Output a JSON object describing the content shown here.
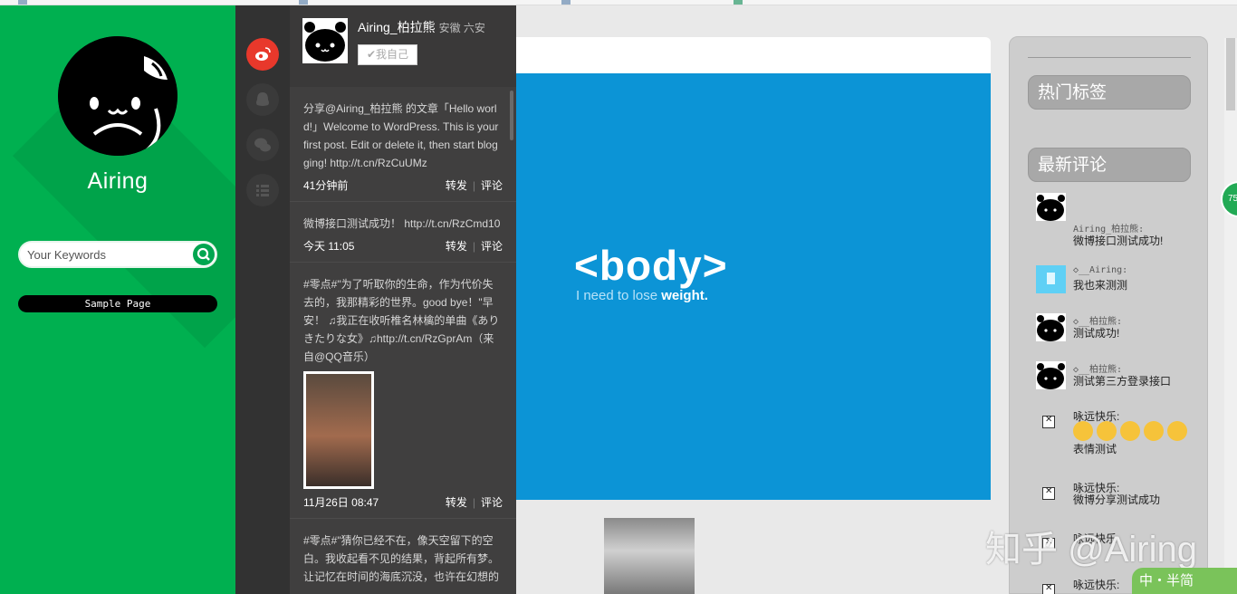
{
  "sidebar": {
    "site_title": "Airing",
    "search_placeholder": "Your Keywords",
    "menu": [
      "Sample Page"
    ],
    "avatar_signature": "Airing"
  },
  "weibo": {
    "user_name": "Airing_柏拉熊",
    "location": "安徽 六安",
    "self_button": "✔我自己",
    "posts": [
      {
        "text": "分享@Airing_柏拉熊 的文章「Hello world!」Welcome to WordPress. This is your first post. Edit or delete it, then start blogging! http://t.cn/RzCuUMz",
        "time": "41分钟前",
        "repost": "转发",
        "comment": "评论"
      },
      {
        "text": "微博接口测试成功！ http://t.cn/RzCmd10",
        "time": "今天 11:05",
        "repost": "转发",
        "comment": "评论"
      },
      {
        "text": "#零点#\"为了听取你的生命，作为代价失去的，我那精彩的世界。good bye！\"早安！ ♫我正在收听椎名林檎的单曲《ありきたりな女》♫http://t.cn/RzGprAm（来自@QQ音乐）",
        "time": "11月26日 08:47",
        "repost": "转发",
        "comment": "评论"
      },
      {
        "text": "#零点#\"猜你已经不在，像天空留下的空白。我收起看不见的结果，背起所有梦。让记忆在时间的海底沉没，也许在幻想的",
        "time": "",
        "repost": "",
        "comment": ""
      }
    ]
  },
  "main": {
    "banner_title": "<body>",
    "banner_tagline_a": "I need to lose ",
    "banner_tagline_b": "weight."
  },
  "widgets": {
    "hot_tags_title": "热门标签",
    "recent_comments_title": "最新评论",
    "comments": [
      {
        "name": "Airing_柏拉熊:",
        "text": "微博接口测试成功!",
        "avatar": "panda"
      },
      {
        "name": "◇__Airing:",
        "text": "我也来测测",
        "avatar": "cyan"
      },
      {
        "name": "◇__柏拉熊:",
        "text": "测试成功!",
        "avatar": "panda"
      },
      {
        "name": "◇__柏拉熊:",
        "text": "测试第三方登录接口",
        "avatar": "panda"
      },
      {
        "name": "咏远快乐:",
        "text": "表情测试",
        "avatar": "broken"
      },
      {
        "name": "咏远快乐:",
        "text": "微博分享测试成功",
        "avatar": "broken"
      },
      {
        "name": "咏远快乐:",
        "text": "",
        "avatar": "broken"
      },
      {
        "name": "咏远快乐:",
        "text": "",
        "avatar": "broken"
      }
    ]
  },
  "overlay": {
    "watermark": "知乎 @Airing",
    "ime": "中・半简",
    "fab": "75"
  },
  "colors": {
    "sidebar_green": "#00b050",
    "banner_blue": "#0c94d6",
    "weibo_red": "#e8382b",
    "panel_dark": "#403f3f"
  }
}
